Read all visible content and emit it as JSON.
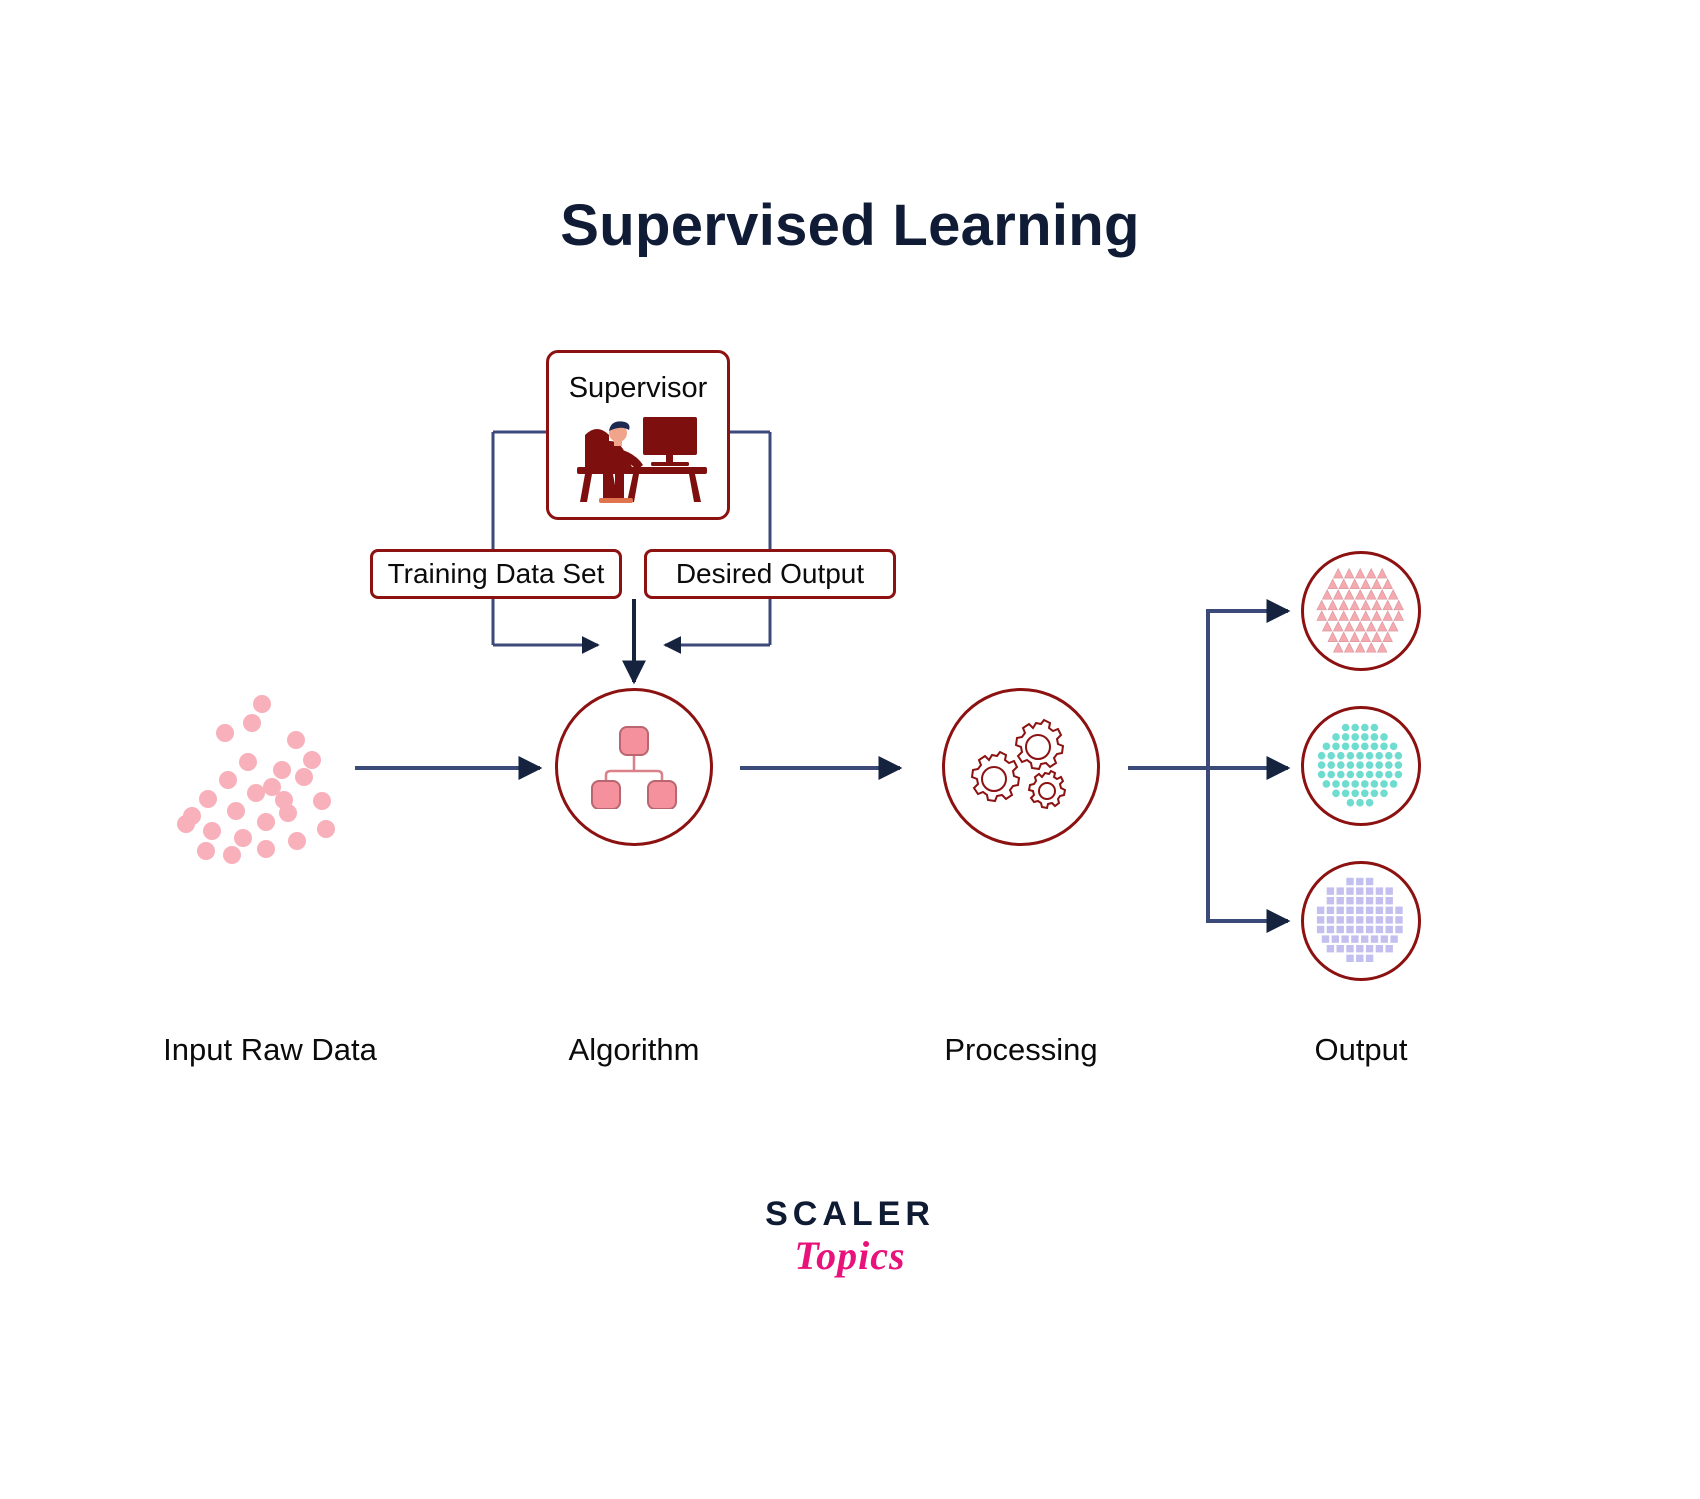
{
  "title": "Supervised Learning",
  "supervisor": {
    "label": "Supervisor",
    "icon": "person-at-computer-icon"
  },
  "boxes": {
    "training": "Training Data Set",
    "desired": "Desired Output"
  },
  "nodes": {
    "algorithm_icon": "hierarchy-tree-icon",
    "processing_icon": "gears-icon"
  },
  "stage_labels": [
    "Input Raw Data",
    "Algorithm",
    "Processing",
    "Output"
  ],
  "outputs": [
    {
      "shape": "triangle",
      "color": "#f6aab0",
      "rows": [
        5,
        6,
        7,
        8,
        8,
        7,
        6,
        5
      ]
    },
    {
      "shape": "circle",
      "color": "#6fdcd0",
      "rows": [
        4,
        6,
        8,
        9,
        9,
        9,
        8,
        6,
        3
      ]
    },
    {
      "shape": "square",
      "color": "#c3c0ef",
      "rows": [
        3,
        7,
        7,
        9,
        9,
        9,
        8,
        7,
        3
      ]
    }
  ],
  "input_dots": {
    "color": "#f8b0bb",
    "count": 26
  },
  "logo": {
    "primary": "SCALER",
    "secondary": "Topics"
  },
  "colors": {
    "title": "#101c36",
    "border_red": "#8c1111",
    "wire_navy": "#3b4a78",
    "arrow_navy": "#16233f",
    "pink": "#f5919c",
    "accent_magenta": "#e8127a"
  }
}
